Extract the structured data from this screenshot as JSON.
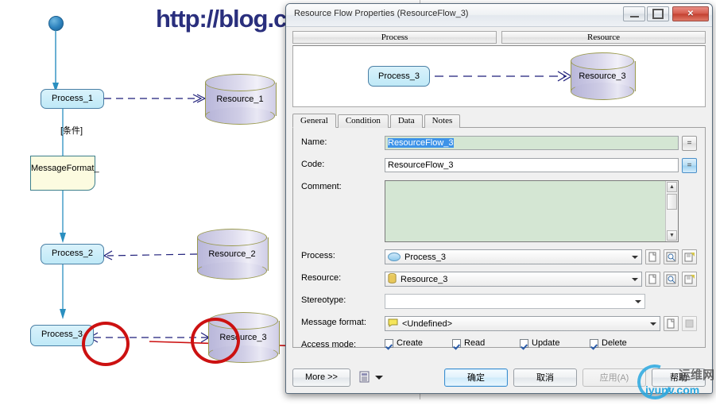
{
  "watermarks": {
    "top": "http://blog.csdn.net/tianlesoftware",
    "bottom_text": "iyunv.com",
    "bottom_cn": "运维网"
  },
  "background_diagram": {
    "nodes": [
      {
        "name": "start-node",
        "label": ""
      },
      {
        "name": "process-1",
        "label": "Process_1"
      },
      {
        "name": "process-2",
        "label": "Process_2"
      },
      {
        "name": "process-3",
        "label": "Process_3"
      },
      {
        "name": "message-format-note",
        "label": "MessageFormat_"
      },
      {
        "name": "resource-1",
        "label": "Resource_1"
      },
      {
        "name": "resource-2",
        "label": "Resource_2"
      },
      {
        "name": "resource-3",
        "label": "Resource_3"
      }
    ],
    "condition_label": "[条件]"
  },
  "dialog": {
    "title": "Resource Flow Properties (ResourceFlow_3)",
    "window_buttons": {
      "minimize": "minimize-button",
      "maximize": "restore-button",
      "close": "✕"
    },
    "preview": {
      "headers": [
        "Process",
        "Resource"
      ],
      "process_node": "Process_3",
      "resource_node": "Resource_3"
    },
    "tabs": [
      {
        "label": "General",
        "active": true
      },
      {
        "label": "Condition",
        "active": false
      },
      {
        "label": "Data",
        "active": false
      },
      {
        "label": "Notes",
        "active": false
      }
    ],
    "fields": {
      "name_label": "Name:",
      "name_value": "ResourceFlow_3",
      "code_label": "Code:",
      "code_value": "ResourceFlow_3",
      "comment_label": "Comment:",
      "comment_value": "",
      "process_label": "Process:",
      "process_value": "Process_3",
      "resource_label": "Resource:",
      "resource_value": "Resource_3",
      "stereotype_label": "Stereotype:",
      "stereotype_value": "",
      "message_format_label": "Message format:",
      "message_format_value": "<Undefined>",
      "access_mode_label": "Access mode:"
    },
    "access_mode": [
      {
        "label": "Create",
        "checked": true
      },
      {
        "label": "Read",
        "checked": true
      },
      {
        "label": "Update",
        "checked": true
      },
      {
        "label": "Delete",
        "checked": true
      }
    ],
    "buttons": {
      "more": "More >>",
      "report_icon": "report-icon",
      "ok": "确定",
      "cancel": "取消",
      "apply": "应用(A)",
      "help": "帮助"
    },
    "equals_buttons": [
      "=",
      "="
    ]
  },
  "colors": {
    "accent": "#3d93e8",
    "green_field": "#d4e6d3",
    "close_red": "#c23f2f",
    "annotation_red": "#cc1111",
    "process_fill": "#bfe9f7",
    "resource_fill": "#cfcde6",
    "note_fill": "#fcfbe0"
  }
}
